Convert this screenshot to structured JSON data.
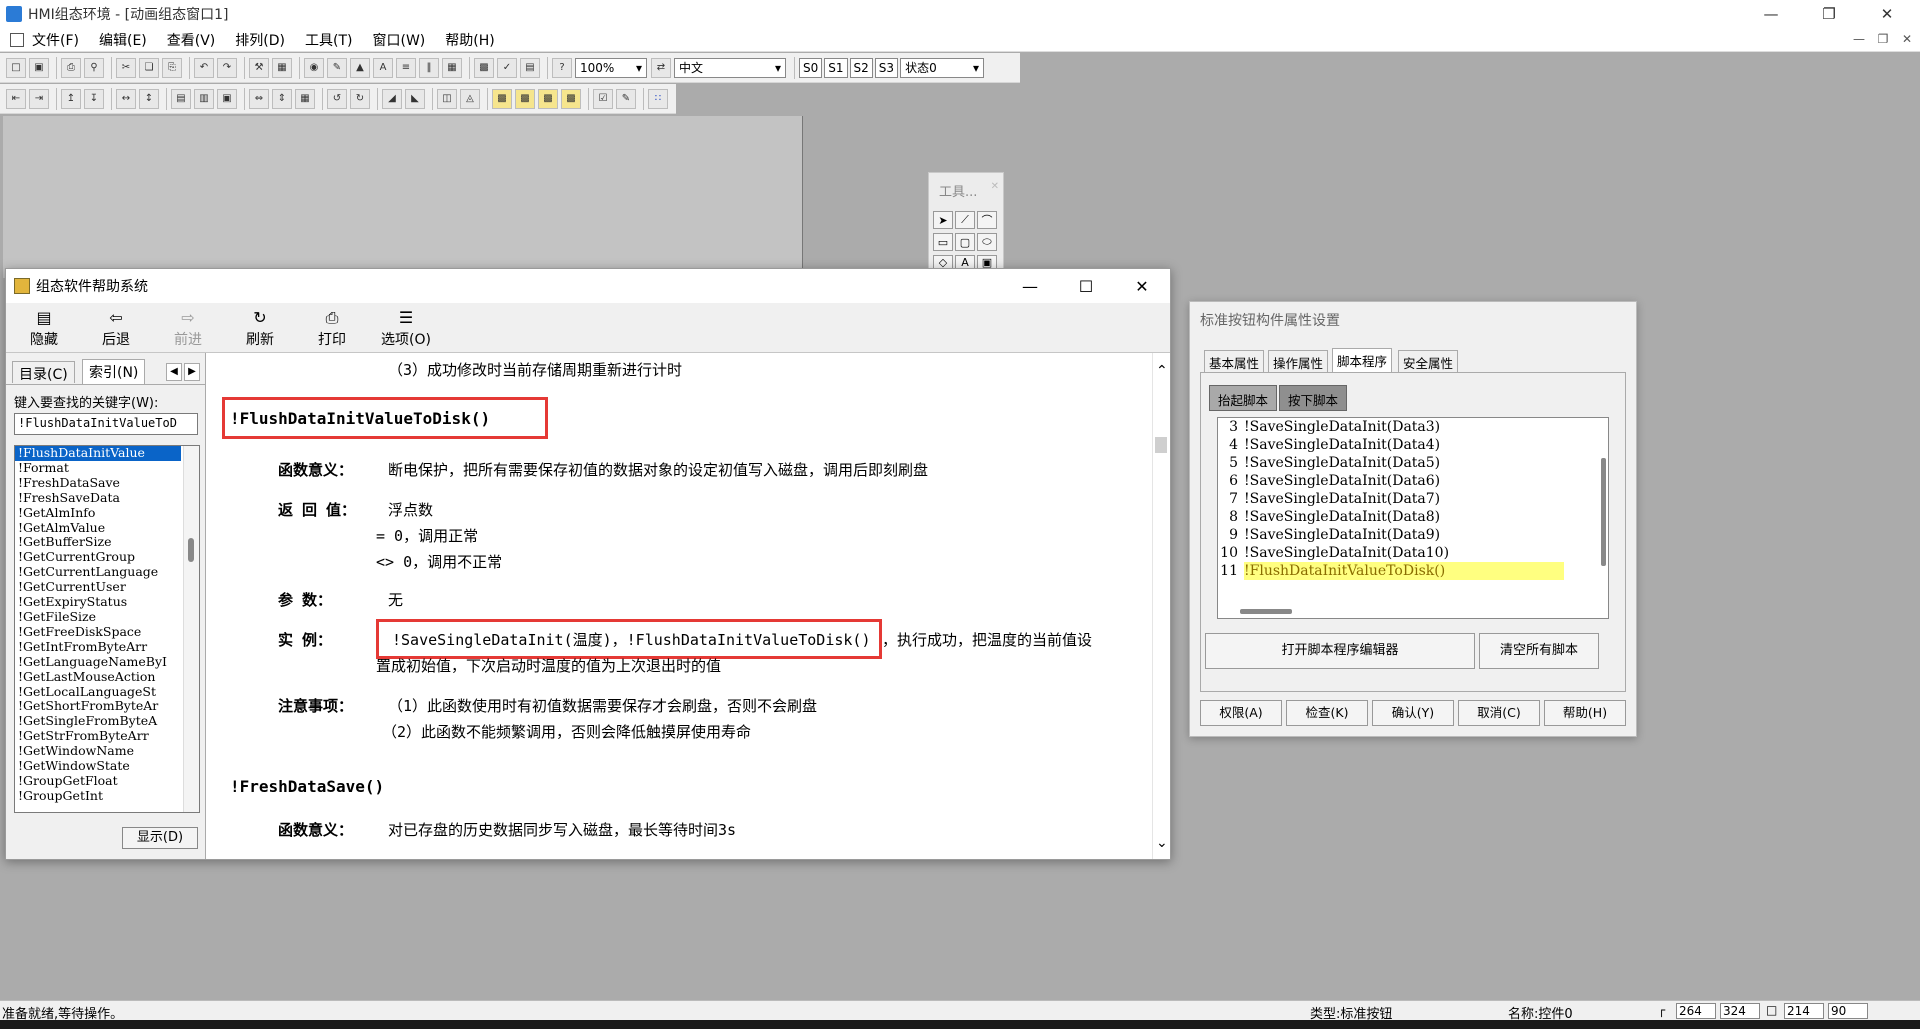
{
  "window": {
    "title": "HMI组态环境 - [动画组态窗口1]"
  },
  "menu": [
    "文件(F)",
    "编辑(E)",
    "查看(V)",
    "排列(D)",
    "工具(T)",
    "窗口(W)",
    "帮助(H)"
  ],
  "toolbar": {
    "zoom": "100%",
    "language": "中文",
    "states": [
      "S0",
      "S1",
      "S2",
      "S3"
    ],
    "state_select": "状态0"
  },
  "palette": {
    "title": "工具..."
  },
  "help": {
    "title": "组态软件帮助系统",
    "tools": [
      "隐藏",
      "后退",
      "前进",
      "刷新",
      "打印",
      "选项(O)"
    ],
    "tabs": [
      "目录(C)",
      "索引(N)"
    ],
    "search_label": "键入要查找的关键字(W):",
    "search_value": "!FlushDataInitValueToD",
    "list": [
      "!FlushDataInitValue",
      "!Format",
      "!FreshDataSave",
      "!FreshSaveData",
      "!GetAlmInfo",
      "!GetAlmValue",
      "!GetBufferSize",
      "!GetCurrentGroup",
      "!GetCurrentLanguage",
      "!GetCurrentUser",
      "!GetExpiryStatus",
      "!GetFileSize",
      "!GetFreeDiskSpace",
      "!GetIntFromByteArr",
      "!GetLanguageNameByI",
      "!GetLastMouseAction",
      "!GetLocalLanguageSt",
      "!GetShortFromByteAr",
      "!GetSingleFromByteA",
      "!GetStrFromByteArr",
      "!GetWindowName",
      "!GetWindowState",
      "!GroupGetFloat",
      "!GroupGetInt"
    ],
    "show_button": "显示(D)",
    "content": {
      "prev_line": "（3）成功修改时当前存储周期重新进行计时",
      "fn1": "!FlushDataInitValueToDisk()",
      "meaning_label": "函数意义：",
      "meaning1": "断电保护，把所有需要保存初值的数据对象的设定初值写入磁盘，调用后即刻刷盘",
      "return_label": "返 回 值：",
      "return_type": "浮点数",
      "ret_ok": "= 0，调用正常",
      "ret_err": "<> 0，调用不正常",
      "param_label": "参     数：",
      "param_val": "无",
      "example_label": "实     例：",
      "example_code": "!SaveSingleDataInit(温度)，!FlushDataInitValueToDisk()",
      "example_rest": "，执行成功，把温度的当前值设",
      "example_line2": "置成初始值，下次启动时温度的值为上次退出时的值",
      "note_label": "注意事项：",
      "note1": "（1）此函数使用时有初值数据需要保存才会刷盘，否则不会刷盘",
      "note2": "（2）此函数不能频繁调用，否则会降低触摸屏使用寿命",
      "fn2": "!FreshDataSave()",
      "meaning2": "对已存盘的历史数据同步写入磁盘，最长等待时间3s"
    }
  },
  "props": {
    "title": "标准按钮构件属性设置",
    "tabs": [
      "基本属性",
      "操作属性",
      "脚本程序",
      "安全属性"
    ],
    "sub_tabs": [
      "抬起脚本",
      "按下脚本"
    ],
    "code_lines": [
      {
        "n": "3",
        "t": "!SaveSingleDataInit(Data3)"
      },
      {
        "n": "4",
        "t": "!SaveSingleDataInit(Data4)"
      },
      {
        "n": "5",
        "t": "!SaveSingleDataInit(Data5)"
      },
      {
        "n": "6",
        "t": "!SaveSingleDataInit(Data6)"
      },
      {
        "n": "7",
        "t": "!SaveSingleDataInit(Data7)"
      },
      {
        "n": "8",
        "t": "!SaveSingleDataInit(Data8)"
      },
      {
        "n": "9",
        "t": "!SaveSingleDataInit(Data9)"
      },
      {
        "n": "10",
        "t": "!SaveSingleDataInit(Data10)"
      },
      {
        "n": "11",
        "t": "!FlushDataInitValueToDisk()"
      }
    ],
    "open_editor": "打开脚本程序编辑器",
    "clear_scripts": "清空所有脚本",
    "bottom": [
      "权限(A)",
      "检查(K)",
      "确认(Y)",
      "取消(C)",
      "帮助(H)"
    ]
  },
  "status": {
    "text": "准备就绪,等待操作。",
    "type": "类型:标准按钮",
    "name": "名称:控件0",
    "x": "264",
    "y": "324",
    "w": "214",
    "h": "90"
  }
}
